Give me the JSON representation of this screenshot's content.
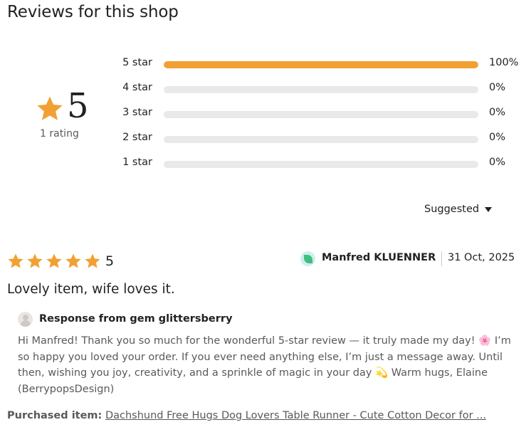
{
  "heading": "Reviews for this shop",
  "summary": {
    "average": "5",
    "rating_count": "1 rating",
    "star_color": "#f1a133"
  },
  "distribution": [
    {
      "label": "5 star",
      "percent_text": "100%",
      "fraction": 1.0
    },
    {
      "label": "4 star",
      "percent_text": "0%",
      "fraction": 0
    },
    {
      "label": "3 star",
      "percent_text": "0%",
      "fraction": 0
    },
    {
      "label": "2 star",
      "percent_text": "0%",
      "fraction": 0
    },
    {
      "label": "1 star",
      "percent_text": "0%",
      "fraction": 0
    }
  ],
  "sort": {
    "label": "Suggested",
    "icon": "caret-down-icon"
  },
  "review": {
    "stars": 5,
    "score": "5",
    "reviewer": "Manfred KLUENNER",
    "reviewer_avatar_icon": "leaf-avatar-icon",
    "date": "31 Oct, 2025",
    "text": "Lovely item, wife loves it.",
    "response": {
      "title": "Response from gem glittersberry",
      "body": "Hi Manfred! Thank you so much for the wonderful 5-star review — it truly made my day! 🌸 I’m so happy you loved your order. If you ever need anything else, I’m just a message away. Until then, wishing you joy, creativity, and a sprinkle of magic in your day 💫 Warm hugs, Elaine (BerrypopsDesign)"
    },
    "purchased_label": "Purchased item:",
    "purchased_item": "Dachshund Free Hugs Dog Lovers Table Runner - Cute Cotton Decor for ..."
  }
}
